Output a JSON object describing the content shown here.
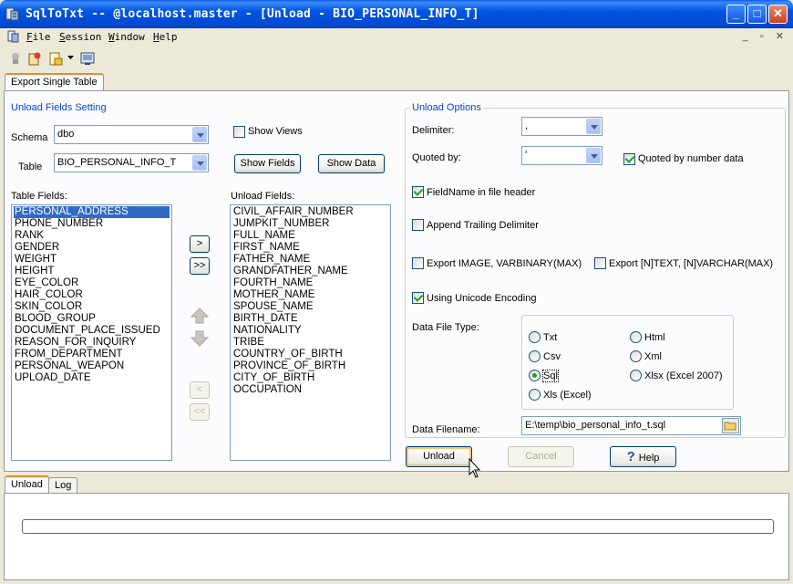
{
  "window": {
    "title": "SqlToTxt -- @localhost.master - [Unload - BIO_PERSONAL_INFO_T]",
    "min_glyph": "_",
    "max_glyph": "□",
    "close_glyph": "✕"
  },
  "menu": {
    "items": [
      {
        "first": "F",
        "rest": "ile"
      },
      {
        "first": "S",
        "rest": "ession"
      },
      {
        "first": "W",
        "rest": "indow"
      },
      {
        "first": "H",
        "rest": "elp"
      }
    ],
    "mdi_min": "_",
    "mdi_restore": "▫",
    "mdi_close": "✕"
  },
  "main_tabs": {
    "export_single_table": "Export Single Table"
  },
  "fields_setting": {
    "title": "Unload Fields Setting",
    "schema_label": "Schema",
    "schema_value": "dbo",
    "table_label": "Table",
    "table_value": "BIO_PERSONAL_INFO_T",
    "show_views_label": "Show Views",
    "show_views_checked": false,
    "show_fields_button": "Show Fields",
    "show_data_button": "Show Data",
    "table_fields_label": "Table Fields:",
    "unload_fields_label": "Unload Fields:",
    "table_fields": [
      "PERSONAL_ADDRESS",
      "PHONE_NUMBER",
      "RANK",
      "GENDER",
      "WEIGHT",
      "HEIGHT",
      "EYE_COLOR",
      "HAIR_COLOR",
      "SKIN_COLOR",
      "BLOOD_GROUP",
      "DOCUMENT_PLACE_ISSUED",
      "REASON_FOR_INQUIRY",
      "FROM_DEPARTMENT",
      "PERSONAL_WEAPON",
      "UPLOAD_DATE"
    ],
    "selected_table_field": "PERSONAL_ADDRESS",
    "unload_fields": [
      "CIVIL_AFFAIR_NUMBER",
      "JUMPKIT_NUMBER",
      "FULL_NAME",
      "FIRST_NAME",
      "FATHER_NAME",
      "GRANDFATHER_NAME",
      "FOURTH_NAME",
      "MOTHER_NAME",
      "SPOUSE_NAME",
      "BIRTH_DATE",
      "NATIONALITY",
      "TRIBE",
      "COUNTRY_OF_BIRTH",
      "PROVINCE_OF_BIRTH",
      "CITY_OF_BIRTH",
      "OCCUPATION"
    ],
    "move_right": ">",
    "move_all_right": ">>",
    "move_left": "<",
    "move_all_left": "<<"
  },
  "unload_options": {
    "title": "Unload Options",
    "delimiter_label": "Delimiter:",
    "delimiter_value": ",",
    "quoted_by_label": "Quoted by:",
    "quoted_by_value": "'",
    "quoted_by_number_label": "Quoted by number data",
    "quoted_by_number_checked": true,
    "fieldname_header_label": "FieldName in file header",
    "fieldname_header_checked": true,
    "append_trailing_label": "Append Trailing Delimiter",
    "append_trailing_checked": false,
    "export_image_label": "Export IMAGE, VARBINARY(MAX)",
    "export_image_checked": false,
    "export_ntext_label": "Export [N]TEXT, [N]VARCHAR(MAX)",
    "export_ntext_checked": false,
    "unicode_label": "Using Unicode Encoding",
    "unicode_checked": true,
    "data_file_type_label": "Data File Type:",
    "file_types": {
      "txt": "Txt",
      "html": "Html",
      "csv": "Csv",
      "xml": "Xml",
      "sql": "Sql",
      "xlsx": "Xlsx (Excel 2007)",
      "xls": "Xls (Excel)"
    },
    "selected_file_type": "Sql",
    "data_filename_label": "Data Filename:",
    "data_filename_value": "E:\\temp\\bio_personal_info_t.sql"
  },
  "actions": {
    "unload": "Unload",
    "cancel": "Cancel",
    "help": "Help",
    "help_icon": "?"
  },
  "bottom_tabs": {
    "unload": "Unload",
    "log": "Log"
  },
  "progress": {
    "value": 0
  }
}
